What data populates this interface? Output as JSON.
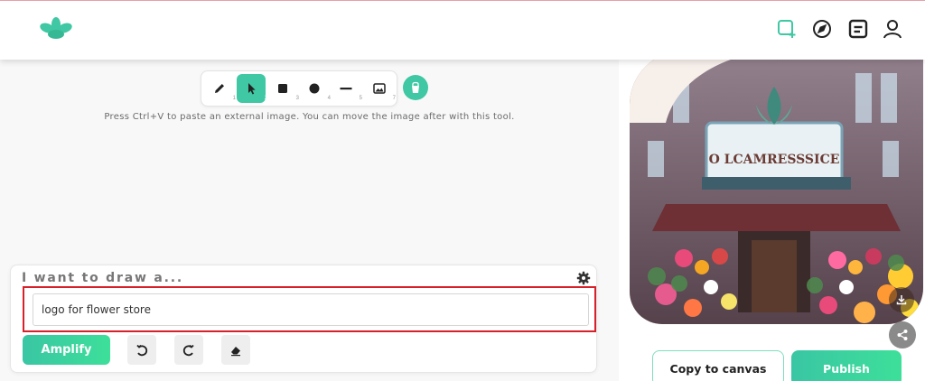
{
  "brand": {
    "logo_icon": "lotus-logo-icon",
    "accent_color": "#3fc8a3"
  },
  "nav": {
    "items": [
      {
        "name": "new-canvas-icon",
        "color": "#3fc8a3"
      },
      {
        "name": "compass-icon",
        "color": "#222222"
      },
      {
        "name": "feed-icon",
        "color": "#222222"
      },
      {
        "name": "user-icon",
        "color": "#222222"
      }
    ]
  },
  "toolbar": {
    "tools": [
      {
        "icon": "pencil-icon",
        "num": "1",
        "active": false
      },
      {
        "icon": "pointer-icon",
        "num": "2",
        "active": true
      },
      {
        "icon": "square-icon",
        "num": "3",
        "active": false
      },
      {
        "icon": "circle-icon",
        "num": "4",
        "active": false
      },
      {
        "icon": "line-icon",
        "num": "5",
        "active": false
      },
      {
        "icon": "image-icon",
        "num": "7",
        "active": false
      }
    ],
    "extra_icon": "bucket-icon"
  },
  "hint_text": "Press Ctrl+V to paste an external image. You can move the image after with this tool.",
  "prompt": {
    "title": "I want to draw a...",
    "value": "logo for flower store",
    "settings_icon": "gear-icon"
  },
  "actions": {
    "amplify_label": "Amplify",
    "undo_icon": "undo-icon",
    "redo_icon": "redo-icon",
    "eraser_icon": "eraser-icon"
  },
  "result": {
    "sign_text": "O LCAMRESSSICE",
    "copy_label": "Copy to canvas",
    "publish_label": "Publish",
    "download_icon": "download-icon",
    "share_icon": "share-icon"
  }
}
